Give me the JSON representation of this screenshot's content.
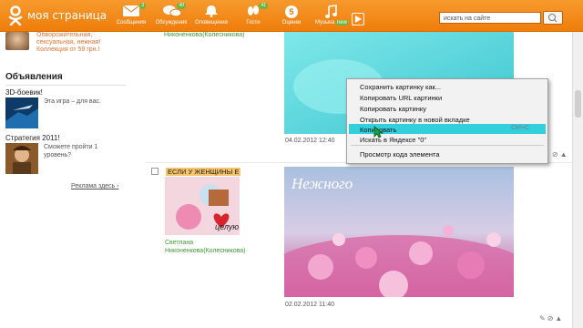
{
  "topbar": {
    "brand": "моя страница",
    "nav": [
      {
        "label": "Сообщения",
        "badge": "3",
        "icon": "envelope-icon"
      },
      {
        "label": "Обсуждения",
        "badge": "40",
        "icon": "chat-bubbles-icon"
      },
      {
        "label": "Оповещения",
        "badge": "",
        "icon": "bell-icon"
      },
      {
        "label": "Гости",
        "badge": "41",
        "icon": "footprints-icon"
      },
      {
        "label": "Оценки",
        "badge": "",
        "icon": "rating-icon",
        "badge_value": "5"
      },
      {
        "label": "Музыка",
        "badge": "new",
        "icon": "music-note-icon"
      }
    ],
    "search_placeholder": "искать на сайте",
    "accent": "#f28b1a"
  },
  "left": {
    "promo_text": "Обворожительная, сексуальная, нежная! Коллекция от 59 грн.!",
    "section_title": "Объявления",
    "ads": [
      {
        "title": "3D-боевик!",
        "text": "Эта игра – для вас."
      },
      {
        "title": "Стратегия 2011!",
        "text": "Сможете пройти 1 уровень?"
      }
    ],
    "ads_link": "Реклама здесь ›"
  },
  "posts": [
    {
      "author": "Никоненкова(Колесникова)",
      "date": "04.02.2012 12:40"
    },
    {
      "card_label": "ЕСЛИ У ЖЕНЩИНЫ Е",
      "author_first": "Светлана",
      "author": "Никоненкова(Колесникова)",
      "image_title": "Нежного",
      "date": "02.02.2012 11:40",
      "thumb_word": "целую"
    }
  ],
  "context_menu": {
    "items": [
      "Сохранить картинку как...",
      "Копировать URL картинки",
      "Копировать картинку",
      "Открыть картинку в новой вкладке",
      "Копировать",
      "Искать в Яндексе \"0\"",
      "Просмотр кода элемента"
    ],
    "highlighted_hint": "Ctrl+C",
    "highlight_color": "#32d0dd"
  }
}
